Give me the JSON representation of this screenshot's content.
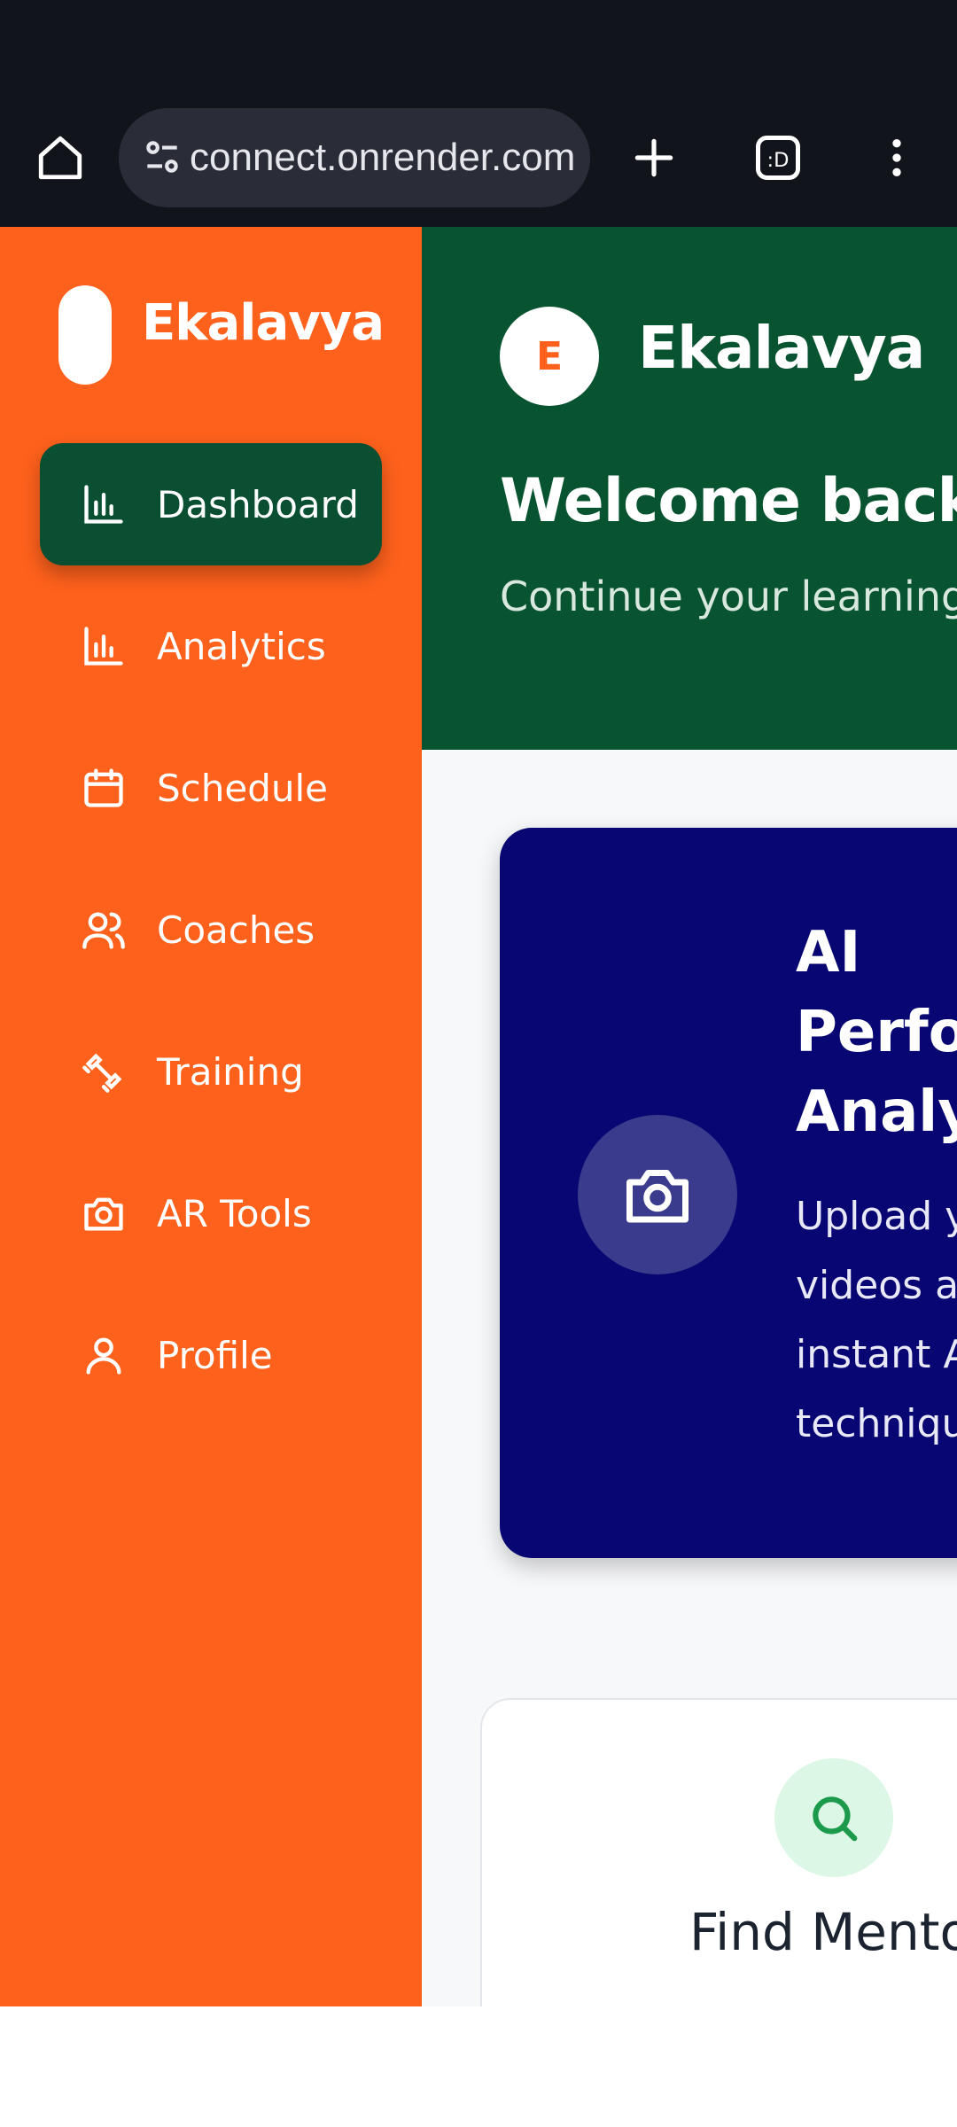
{
  "browser": {
    "url": "connect.onrender.com",
    "icons": [
      "home-icon",
      "site-info-icon",
      "new-tab-icon",
      "tab-switcher-icon",
      "menu-icon"
    ]
  },
  "sidebar": {
    "brand": "Ekalavya",
    "items": [
      {
        "label": "Dashboard",
        "icon": "bar-chart-icon",
        "active": true
      },
      {
        "label": "Analytics",
        "icon": "bar-chart-icon",
        "active": false
      },
      {
        "label": "Schedule",
        "icon": "calendar-icon",
        "active": false
      },
      {
        "label": "Coaches",
        "icon": "users-icon",
        "active": false
      },
      {
        "label": "Training",
        "icon": "dumbbell-icon",
        "active": false
      },
      {
        "label": "AR Tools",
        "icon": "camera-icon",
        "active": false
      },
      {
        "label": "Profile",
        "icon": "user-icon",
        "active": false
      }
    ]
  },
  "hero": {
    "avatar_letter": "E",
    "brand": "Ekalavya",
    "welcome": "Welcome back,",
    "subtitle": "Continue your learning j"
  },
  "ai_card": {
    "title_lines": [
      "AI",
      "Perfo",
      "Analy"
    ],
    "desc_lines": [
      "Upload y",
      "videos ar",
      "instant A",
      "techniqu"
    ],
    "icon": "camera-icon"
  },
  "mentor_card": {
    "title": "Find Mento",
    "icon": "search-icon"
  },
  "colors": {
    "sidebar": "#fe611c",
    "active_nav": "#0a4f31",
    "hero": "#085430",
    "ai_card": "#070672",
    "browser_bar": "#12141c"
  }
}
